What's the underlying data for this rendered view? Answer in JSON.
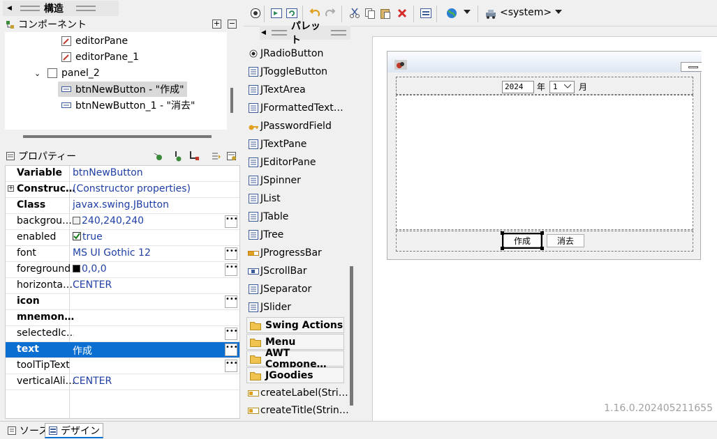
{
  "structure": {
    "title": "構造",
    "components_label": "コンポーネント",
    "tree": [
      {
        "label": "editorPane",
        "depth": 2
      },
      {
        "label": "editorPane_1",
        "depth": 2
      },
      {
        "label": "panel_2",
        "depth": 1
      },
      {
        "label": "btnNewButton - \"作成\"",
        "depth": 2,
        "selected": true
      },
      {
        "label": "btnNewButton_1 - \"消去\"",
        "depth": 2
      }
    ]
  },
  "properties": {
    "title": "プロパティー",
    "rows": [
      {
        "key": "Variable",
        "value": "btnNewButton",
        "bold": true
      },
      {
        "key": "Constructor",
        "value": "(Constructor properties)",
        "bold": true,
        "expandable": true
      },
      {
        "key": "Class",
        "value": "javax.swing.JButton",
        "bold": true
      },
      {
        "key": "background",
        "value": "240,240,240",
        "swatch": "#f0f0f0",
        "button": true
      },
      {
        "key": "enabled",
        "value": "true",
        "checkbox": true
      },
      {
        "key": "font",
        "value": "MS UI Gothic 12",
        "button": true
      },
      {
        "key": "foreground",
        "value": "0,0,0",
        "swatch": "#000000",
        "button": true
      },
      {
        "key": "horizontalAlignment",
        "value": "CENTER"
      },
      {
        "key": "icon",
        "value": "",
        "bold": true,
        "button": true
      },
      {
        "key": "mnemonic",
        "value": "",
        "bold": true
      },
      {
        "key": "selectedIcon",
        "value": "",
        "button": true
      },
      {
        "key": "text",
        "value": "作成",
        "bold": true,
        "button": true,
        "active": true
      },
      {
        "key": "toolTipText",
        "value": "",
        "button": true
      },
      {
        "key": "verticalAlignment",
        "value": "CENTER"
      }
    ],
    "key_display": [
      "Variable",
      "Construc…",
      "Class",
      "backgrou…",
      "enabled",
      "font",
      "foreground",
      "horizonta…",
      "icon",
      "mnemon…",
      "selectedIc…",
      "text",
      "toolTipText",
      "verticalAli…"
    ]
  },
  "palette": {
    "title": "パレット",
    "items": [
      "JRadioButton",
      "JToggleButton",
      "JTextArea",
      "JFormattedText…",
      "JPasswordField",
      "JTextPane",
      "JEditorPane",
      "JSpinner",
      "JList",
      "JTable",
      "JTree",
      "JProgressBar",
      "JScrollBar",
      "JSeparator",
      "JSlider"
    ],
    "categories": [
      "Swing Actions",
      "Menu",
      "AWT Compone…",
      "JGoodies"
    ],
    "factory_items": [
      "createLabel(Stri…",
      "createTitle(Strin…"
    ]
  },
  "toolbar": {
    "laf_label": "<system>"
  },
  "design": {
    "year_value": "2024",
    "year_suffix": "年",
    "month_value": "1",
    "month_suffix": "月",
    "create_button": "作成",
    "clear_button": "消去",
    "version": "1.16.0.202405211655"
  },
  "bottom_tabs": {
    "source": "ソース",
    "design": "デザイン"
  }
}
